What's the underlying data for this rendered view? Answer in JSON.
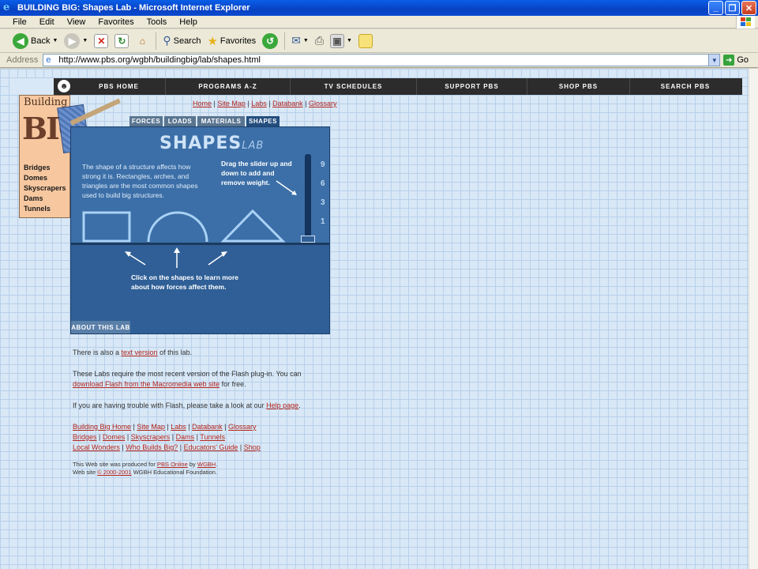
{
  "window": {
    "title": "BUILDING BIG: Shapes Lab - Microsoft Internet Explorer",
    "minimize": "_",
    "maximize": "❐",
    "close": "✕"
  },
  "menu": [
    "File",
    "Edit",
    "View",
    "Favorites",
    "Tools",
    "Help"
  ],
  "toolbar": {
    "back": "Back",
    "search": "Search",
    "favorites": "Favorites"
  },
  "address": {
    "label": "Address",
    "url": "http://www.pbs.org/wgbh/buildingbig/lab/shapes.html",
    "go": "Go"
  },
  "pbs_nav": [
    "PBS HOME",
    "PROGRAMS A-Z",
    "TV SCHEDULES",
    "SUPPORT PBS",
    "SHOP PBS",
    "SEARCH PBS"
  ],
  "sidebar": {
    "logo_top": "Building",
    "logo_big": "BIG",
    "links": [
      "Bridges",
      "Domes",
      "Skyscrapers",
      "Dams",
      "Tunnels"
    ]
  },
  "top_links": [
    "Home",
    "Site Map",
    "Labs",
    "Databank",
    "Glossary"
  ],
  "tabs": [
    "FORCES",
    "LOADS",
    "MATERIALS",
    "SHAPES"
  ],
  "lab": {
    "title": "SHAPES",
    "title_sub": "LAB",
    "intro": "The shape of a structure affects how strong it is. Rectangles, arches, and triangles are the most common shapes used to build big structures.",
    "drag": "Drag the slider up and down to add and remove weight.",
    "ticks": [
      "9",
      "6",
      "3",
      "1"
    ],
    "click_pre": "Click on the shapes to learn more about how ",
    "click_link": "forces",
    "click_post": " affect them.",
    "about": "ABOUT THIS LAB"
  },
  "body": {
    "p1_pre": "There is also a ",
    "p1_link": "text version",
    "p1_post": " of this lab.",
    "p2_pre": "These Labs require the most recent version of the Flash plug-in. You can ",
    "p2_link": "download Flash from the Macromedia web site",
    "p2_post": " for free.",
    "p3_pre": "If you are having trouble with Flash, please take a look at our ",
    "p3_link": "Help page",
    "p3_post": "."
  },
  "footer_links": {
    "row1": [
      "Building Big Home",
      "Site Map",
      "Labs",
      "Databank",
      "Glossary"
    ],
    "row2": [
      "Bridges",
      "Domes",
      "Skyscrapers",
      "Dams",
      "Tunnels"
    ],
    "row3": [
      "Local Wonders",
      "Who Builds Big?",
      "Educators' Guide",
      "Shop"
    ]
  },
  "credits": {
    "line1_pre": "This Web site was produced for ",
    "line1_link1": "PBS Online",
    "line1_mid": " by ",
    "line1_link2": "WGBH",
    "line1_post": ".",
    "line2_pre": "Web site ",
    "line2_link": "© 2000-2001",
    "line2_post": " WGBH Educational Foundation."
  }
}
